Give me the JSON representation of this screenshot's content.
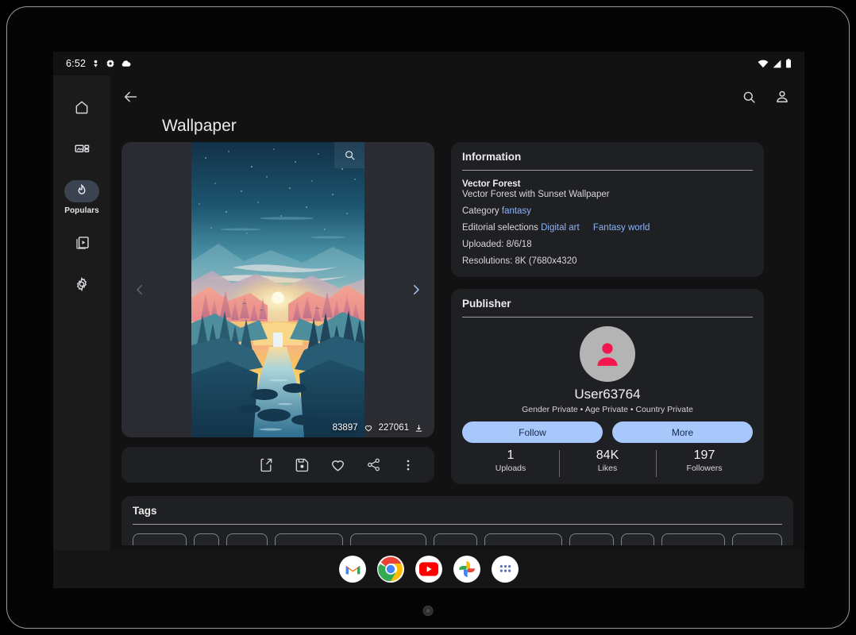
{
  "status_bar": {
    "time": "6:52",
    "left_icons": [
      "download-icon",
      "settings-sync-icon",
      "cloud-icon"
    ],
    "right_icons": [
      "wifi-icon",
      "cellular-signal-icon",
      "battery-icon"
    ]
  },
  "nav_rail": {
    "items": [
      {
        "icon": "home-icon",
        "label": "",
        "active": false,
        "name": "home"
      },
      {
        "icon": "collections-icon",
        "label": "",
        "active": false,
        "name": "categories"
      },
      {
        "icon": "fire-icon",
        "label": "Populars",
        "active": true,
        "name": "populars"
      },
      {
        "icon": "slideshow-icon",
        "label": "",
        "active": false,
        "name": "slideshow"
      },
      {
        "icon": "gear-icon",
        "label": "",
        "active": false,
        "name": "settings"
      }
    ]
  },
  "app_bar": {
    "back_icon": "arrow-back-icon",
    "search_icon": "search-icon",
    "account_icon": "account-icon"
  },
  "page_title": "Wallpaper",
  "viewer": {
    "zoom_icon": "search-zoom-icon",
    "prev_icon": "chevron-left-icon",
    "next_icon": "chevron-right-icon",
    "downloads_count": "83897",
    "likes_count": "227061",
    "heart_icon": "heart-icon",
    "download_icon": "download-icon"
  },
  "action_bar": {
    "actions": [
      {
        "name": "set-wallpaper",
        "icon": "set-as-wallpaper-icon"
      },
      {
        "name": "save",
        "icon": "save-icon"
      },
      {
        "name": "favorite",
        "icon": "heart-icon"
      },
      {
        "name": "share",
        "icon": "share-icon"
      },
      {
        "name": "more",
        "icon": "more-vert-icon"
      }
    ]
  },
  "information": {
    "title": "Information",
    "name": "Vector Forest",
    "description": "Vector Forest with Sunset Wallpaper",
    "category_label": "Category",
    "category_value": "fantasy",
    "editorial_label": "Editorial selections",
    "editorial_values": [
      "Digital art",
      "Fantasy world"
    ],
    "uploaded": "Uploaded: 8/6/18",
    "resolutions": "Resolutions: 8K (7680x4320"
  },
  "publisher": {
    "title": "Publisher",
    "avatar_icon": "person-avatar-icon",
    "username": "User63764",
    "privacy": "Gender Private • Age Private • Country Private",
    "follow_label": "Follow",
    "more_label": "More",
    "stats": [
      {
        "value": "1",
        "label": "Uploads"
      },
      {
        "value": "84K",
        "label": "Likes"
      },
      {
        "value": "197",
        "label": "Followers"
      }
    ]
  },
  "tags": {
    "title": "Tags",
    "chip_widths": [
      78,
      36,
      60,
      98,
      110,
      63,
      112,
      64,
      48,
      92,
      72
    ]
  },
  "taskbar": {
    "apps": [
      {
        "name": "gmail",
        "icon": "gmail-icon"
      },
      {
        "name": "chrome",
        "icon": "chrome-icon"
      },
      {
        "name": "youtube",
        "icon": "youtube-icon"
      },
      {
        "name": "photos",
        "icon": "google-photos-icon"
      },
      {
        "name": "all-apps",
        "icon": "app-drawer-icon"
      }
    ]
  },
  "colors": {
    "accent_blue": "#a8c7fa",
    "link_blue": "#8ab4f8",
    "panel_bg": "#1f2024",
    "rail_bg": "#1b1b1b",
    "screen_bg": "#121212",
    "avatar_person": "#f4174f"
  }
}
